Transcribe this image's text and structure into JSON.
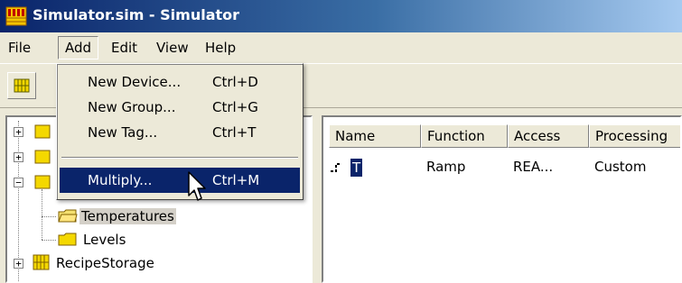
{
  "window": {
    "title": "Simulator.sim - Simulator"
  },
  "menubar": {
    "items": [
      "File",
      "Add",
      "Edit",
      "View",
      "Help"
    ],
    "open": "Add"
  },
  "add_menu": {
    "items": [
      {
        "label": "New Device...",
        "shortcut": "Ctrl+D"
      },
      {
        "label": "New Group...",
        "shortcut": "Ctrl+G"
      },
      {
        "label": "New Tag...",
        "shortcut": "Ctrl+T"
      },
      {
        "label": "Multiply...",
        "shortcut": "Ctrl+M",
        "highlighted": true
      }
    ]
  },
  "tree": {
    "items": [
      {
        "label": "Temperatures",
        "selected": true
      },
      {
        "label": "Levels"
      },
      {
        "label": "RecipeStorage"
      }
    ]
  },
  "list": {
    "columns": [
      "Name",
      "Function",
      "Access",
      "Processing"
    ],
    "rows": [
      {
        "name": "T",
        "function": "Ramp",
        "access": "REA...",
        "processing": "Custom"
      }
    ]
  },
  "icons": {
    "app": "simulator-app-icon",
    "toolbar": "new-device-icon",
    "folder": "folder-icon",
    "tag": "tag-icon",
    "cursor": "mouse-pointer-icon"
  },
  "colors": {
    "highlight": "#0a246a",
    "titlebar_start": "#0a246a",
    "face": "#ece9d8"
  }
}
